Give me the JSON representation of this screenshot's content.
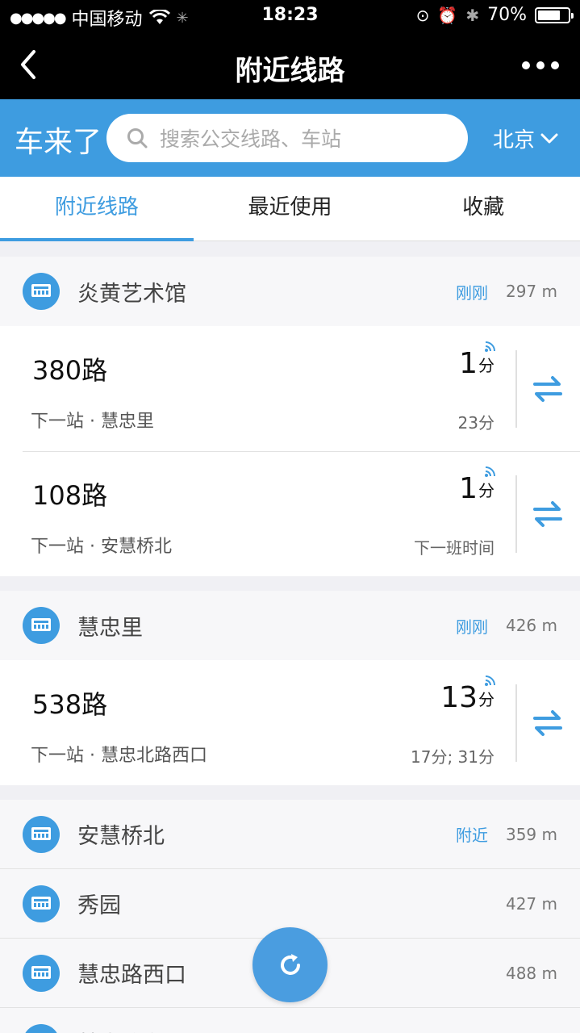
{
  "status_bar": {
    "carrier": "中国移动",
    "time": "18:23",
    "battery": "70%"
  },
  "title_bar": {
    "title": "附近线路"
  },
  "header": {
    "brand": "车来了",
    "search_placeholder": "搜索公交线路、车站",
    "city": "北京"
  },
  "tabs": [
    {
      "label": "附近线路",
      "active": true
    },
    {
      "label": "最近使用",
      "active": false
    },
    {
      "label": "收藏",
      "active": false
    }
  ],
  "stations": [
    {
      "name": "炎黄艺术馆",
      "time": "刚刚",
      "distance": "297 m",
      "routes": [
        {
          "name": "380路",
          "next": "下一站 · 慧忠里",
          "eta": "1",
          "eta_unit": "分",
          "sub": "23分"
        },
        {
          "name": "108路",
          "next": "下一站 · 安慧桥北",
          "eta": "1",
          "eta_unit": "分",
          "sub": "下一班时间"
        }
      ]
    },
    {
      "name": "慧忠里",
      "time": "刚刚",
      "distance": "426 m",
      "routes": [
        {
          "name": "538路",
          "next": "下一站 · 慧忠北路西口",
          "eta": "13",
          "eta_unit": "分",
          "sub": "17分; 31分"
        }
      ]
    }
  ],
  "nearby_stations": [
    {
      "name": "安慧桥北",
      "time": "附近",
      "distance": "359 m"
    },
    {
      "name": "秀园",
      "time": "",
      "distance": "427 m"
    },
    {
      "name": "慧忠路西口",
      "time": "",
      "distance": "488 m"
    },
    {
      "name": "慧忠路东口",
      "time": "",
      "distance": ""
    }
  ],
  "colors": {
    "accent": "#3e9ce0",
    "title_bar": "#000000"
  }
}
